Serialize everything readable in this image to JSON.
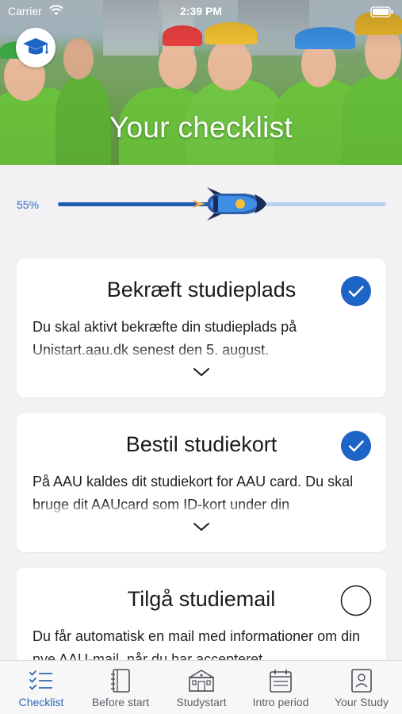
{
  "status_bar": {
    "carrier": "Carrier",
    "time": "2:39 PM"
  },
  "header": {
    "title": "Your checklist",
    "logo": "graduation-cap-icon"
  },
  "progress": {
    "label": "55%",
    "fraction": 0.55,
    "icon": "rocket-icon"
  },
  "colors": {
    "accent": "#1e5fb4",
    "track": "#b6d2f0",
    "check_done": "#1e63c6",
    "tab_active": "#2a66b8",
    "tab_inactive": "#5b6168"
  },
  "checklist": [
    {
      "title": "Bekræft studieplads",
      "body": "Du skal aktivt bekræfte din studieplads på Unistart.aau.dk senest den 5. august.",
      "done": true
    },
    {
      "title": "Bestil studiekort",
      "body": "På AAU kaldes dit studiekort for AAU card. Du skal bruge dit AAUcard som ID-kort under din",
      "done": true
    },
    {
      "title": "Tilgå studiemail",
      "body": "Du får automatisk en mail med informationer om din nye AAU-mail, når du har accepteret",
      "done": false
    }
  ],
  "tabs": [
    {
      "label": "Checklist",
      "icon": "checklist-icon",
      "active": true
    },
    {
      "label": "Before start",
      "icon": "notebook-icon",
      "active": false
    },
    {
      "label": "Studystart",
      "icon": "building-icon",
      "active": false
    },
    {
      "label": "Intro period",
      "icon": "calendar-icon",
      "active": false
    },
    {
      "label": "Your Study",
      "icon": "id-card-icon",
      "active": false
    }
  ]
}
